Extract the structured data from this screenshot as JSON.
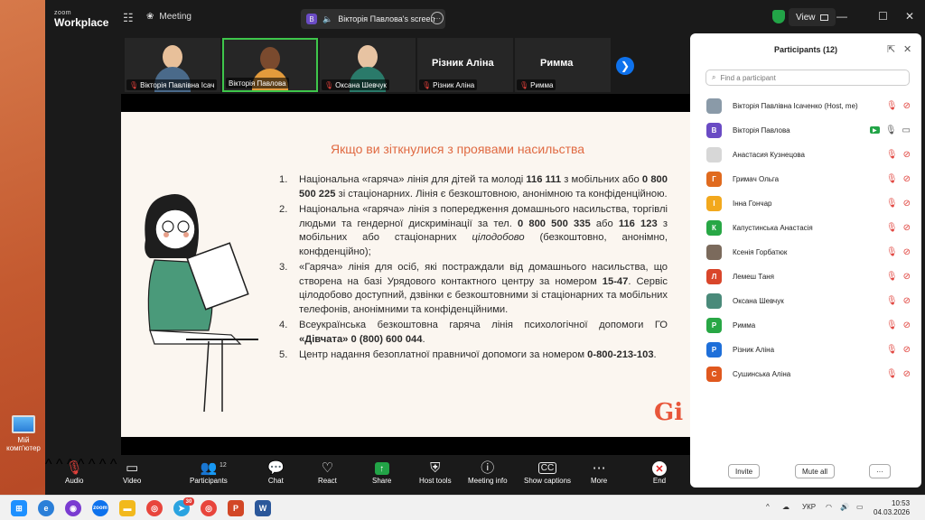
{
  "window": {
    "brand_top": "zoom",
    "brand_bottom": "Workplace",
    "meeting_label": "Meeting",
    "screen_badge": "В",
    "screen_label": "Вікторія Павлова's screen",
    "view_label": "View"
  },
  "thumbnails": [
    {
      "name": "Вікторія Павлівна Ісач",
      "face_color": "#e8c09a",
      "body_color": "#4a6a8a",
      "active": false
    },
    {
      "name": "Вікторія Павлова",
      "face_color": "#7a4a2e",
      "body_color": "#e39b3c",
      "active": true
    },
    {
      "name": "Оксана Шевчук",
      "face_color": "#e7c3a2",
      "body_color": "#2a7a6a",
      "active": false
    },
    {
      "name": "Різник Аліна",
      "video": false
    },
    {
      "name": "Римма",
      "video": false
    }
  ],
  "slide": {
    "title": "Якщо ви зіткнулися з проявами насильства",
    "items": [
      {
        "num": "1.",
        "html": "Національна «гаряча» лінія для дітей та молоді <b>116 111</b> з мобільних або <b>0 800 500 225</b> зі стаціонарних. Лінія є безкоштовною, анонімною та конфіденційною."
      },
      {
        "num": "2.",
        "html": "Національна «гаряча» лінія з попередження домашнього насильства, торгівлі людьми та гендерної дискримінації за тел. <b>0 800 500 335</b> або <b>116 123</b> з мобільних або стаціонарних <i>цілодобово</i> (безкоштовно, анонімно, конфденційно);"
      },
      {
        "num": "3.",
        "html": "«Гаряча» лінія для осіб, які постраждали від домашнього насильства, що створена на базі Урядового контактного центру за номером <b>15-47</b>. Сервіс цілодобово доступний, дзвінки є безкоштовними зі стаціонарних та мобільних телефонів, анонімними та конфіденційними."
      },
      {
        "num": "4.",
        "html": "Всеукраїнська безкоштовна гаряча лінія психологічної допомоги ГО <b>«Дівчата» 0 (800) 600 044</b>."
      },
      {
        "num": "5.",
        "html": "Центр надання безоплатної правничої допомоги за номером <b>0-800-213-103</b>."
      }
    ],
    "logo": "Gi"
  },
  "toolbar": {
    "audio": "Audio",
    "video": "Video",
    "participants": "Participants",
    "participants_count": "12",
    "chat": "Chat",
    "react": "React",
    "share": "Share",
    "host_tools": "Host tools",
    "meeting_info": "Meeting info",
    "show_captions": "Show captions",
    "more": "More",
    "end": "End"
  },
  "panel": {
    "title": "Participants (12)",
    "search_placeholder": "Find a participant",
    "participants": [
      {
        "name": "Вікторія Павлівна Ісаченко (Host, me)",
        "initial": "",
        "color": "#8a9aa8",
        "photo": true,
        "cam": false,
        "mic": false
      },
      {
        "name": "Вікторія Павлова",
        "initial": "В",
        "color": "#6a4bc4",
        "photo": false,
        "cam": true,
        "mic": true
      },
      {
        "name": "Анастасия Кузнецова",
        "initial": "",
        "color": "#d7d7d7",
        "photo": true,
        "cam": false,
        "mic": false
      },
      {
        "name": "Гримач Ольга",
        "initial": "Г",
        "color": "#e06a1e",
        "photo": false,
        "cam": false,
        "mic": false
      },
      {
        "name": "Інна Гончар",
        "initial": "І",
        "color": "#f2a81d",
        "photo": false,
        "cam": false,
        "mic": false
      },
      {
        "name": "Капустинська Анастасія",
        "initial": "К",
        "color": "#28a745",
        "photo": false,
        "cam": false,
        "mic": false
      },
      {
        "name": "Ксенія Горбатюк",
        "initial": "",
        "color": "#7b6a5c",
        "photo": true,
        "cam": false,
        "mic": false
      },
      {
        "name": "Лемеш Таня",
        "initial": "Л",
        "color": "#d9462b",
        "photo": false,
        "cam": false,
        "mic": false
      },
      {
        "name": "Оксана Шевчук",
        "initial": "",
        "color": "#4a8a7a",
        "photo": true,
        "cam": false,
        "mic": false
      },
      {
        "name": "Римма",
        "initial": "Р",
        "color": "#28a745",
        "photo": false,
        "cam": false,
        "mic": false
      },
      {
        "name": "Різник  Аліна",
        "initial": "Р",
        "color": "#1e6fd9",
        "photo": false,
        "cam": false,
        "mic": false
      },
      {
        "name": "Сушинська Аліна",
        "initial": "С",
        "color": "#e0581e",
        "photo": false,
        "cam": false,
        "mic": false
      }
    ],
    "invite": "Invite",
    "mute_all": "Mute all",
    "more": "···"
  },
  "desktop": {
    "icon_label": "Мій комп'ютер"
  },
  "taskbar": {
    "lang": "УКР",
    "time": "10:53",
    "date": "04.03.2026",
    "badge_count": "30"
  }
}
